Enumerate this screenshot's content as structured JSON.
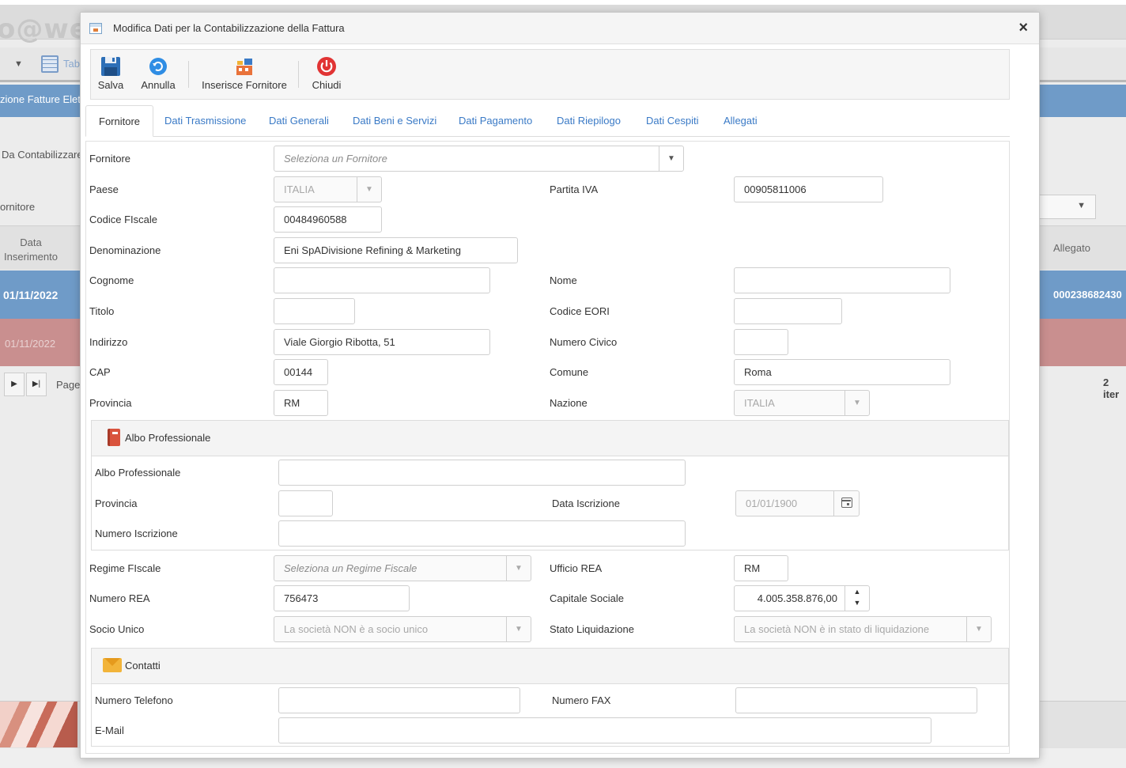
{
  "background": {
    "logo": "o@web",
    "toolbar_tab": "Tab",
    "band_label": "zione Fatture Elett",
    "filter_label": "Da Contabilizzare",
    "fornitore_label": "ornitore",
    "grid_header": {
      "col1": "Data Inserimento",
      "col_last": "Allegato"
    },
    "rows": [
      {
        "date": "01/11/2022",
        "allegato": "000238682430"
      },
      {
        "date": "01/11/2022",
        "allegato": ""
      }
    ],
    "pager": {
      "page_label": "Page",
      "items": "2 iter"
    }
  },
  "modal": {
    "title": "Modifica Dati per la Contabilizzazione della Fattura",
    "close": "×",
    "toolbar": {
      "save": "Salva",
      "cancel": "Annulla",
      "insert_supplier": "Inserisce Fornitore",
      "close": "Chiudi"
    },
    "tabs": [
      "Fornitore",
      "Dati Trasmissione",
      "Dati Generali",
      "Dati Beni e Servizi",
      "Dati Pagamento",
      "Dati Riepilogo",
      "Dati Cespiti",
      "Allegati"
    ],
    "form": {
      "fornitore": {
        "label": "Fornitore",
        "placeholder": "Seleziona un Fornitore"
      },
      "paese": {
        "label": "Paese",
        "value": "ITALIA"
      },
      "partita_iva": {
        "label": "Partita IVA",
        "value": "00905811006"
      },
      "codice_fiscale": {
        "label": "Codice FIscale",
        "value": "00484960588"
      },
      "denominazione": {
        "label": "Denominazione",
        "value": "Eni SpADivisione Refining & Marketing"
      },
      "cognome": {
        "label": "Cognome",
        "value": ""
      },
      "nome": {
        "label": "Nome",
        "value": ""
      },
      "titolo": {
        "label": "Titolo",
        "value": ""
      },
      "codice_eori": {
        "label": "Codice EORI",
        "value": ""
      },
      "indirizzo": {
        "label": "Indirizzo",
        "value": "Viale Giorgio Ribotta, 51"
      },
      "numero_civico": {
        "label": "Numero Civico",
        "value": ""
      },
      "cap": {
        "label": "CAP",
        "value": "00144"
      },
      "comune": {
        "label": "Comune",
        "value": "Roma"
      },
      "provincia": {
        "label": "Provincia",
        "value": "RM"
      },
      "nazione": {
        "label": "Nazione",
        "value": "ITALIA"
      },
      "albo": {
        "section_title": "Albo Professionale",
        "albo_label": "Albo Professionale",
        "albo_value": "",
        "provincia_label": "Provincia",
        "provincia_value": "",
        "data_label": "Data Iscrizione",
        "data_placeholder": "01/01/1900",
        "numero_label": "Numero Iscrizione",
        "numero_value": ""
      },
      "regime_fiscale": {
        "label": "Regime FIscale",
        "placeholder": "Seleziona un Regime Fiscale"
      },
      "ufficio_rea": {
        "label": "Ufficio REA",
        "value": "RM"
      },
      "numero_rea": {
        "label": "Numero REA",
        "value": "756473"
      },
      "capitale_sociale": {
        "label": "Capitale Sociale",
        "value": "4.005.358.876,00"
      },
      "socio_unico": {
        "label": "Socio Unico",
        "value": "La società NON è a socio unico"
      },
      "stato_liquidazione": {
        "label": "Stato Liquidazione",
        "value": "La società NON è in stato di liquidazione"
      },
      "contatti": {
        "section_title": "Contatti",
        "telefono_label": "Numero Telefono",
        "telefono_value": "",
        "fax_label": "Numero FAX",
        "fax_value": "",
        "email_label": "E-Mail",
        "email_value": ""
      }
    }
  }
}
